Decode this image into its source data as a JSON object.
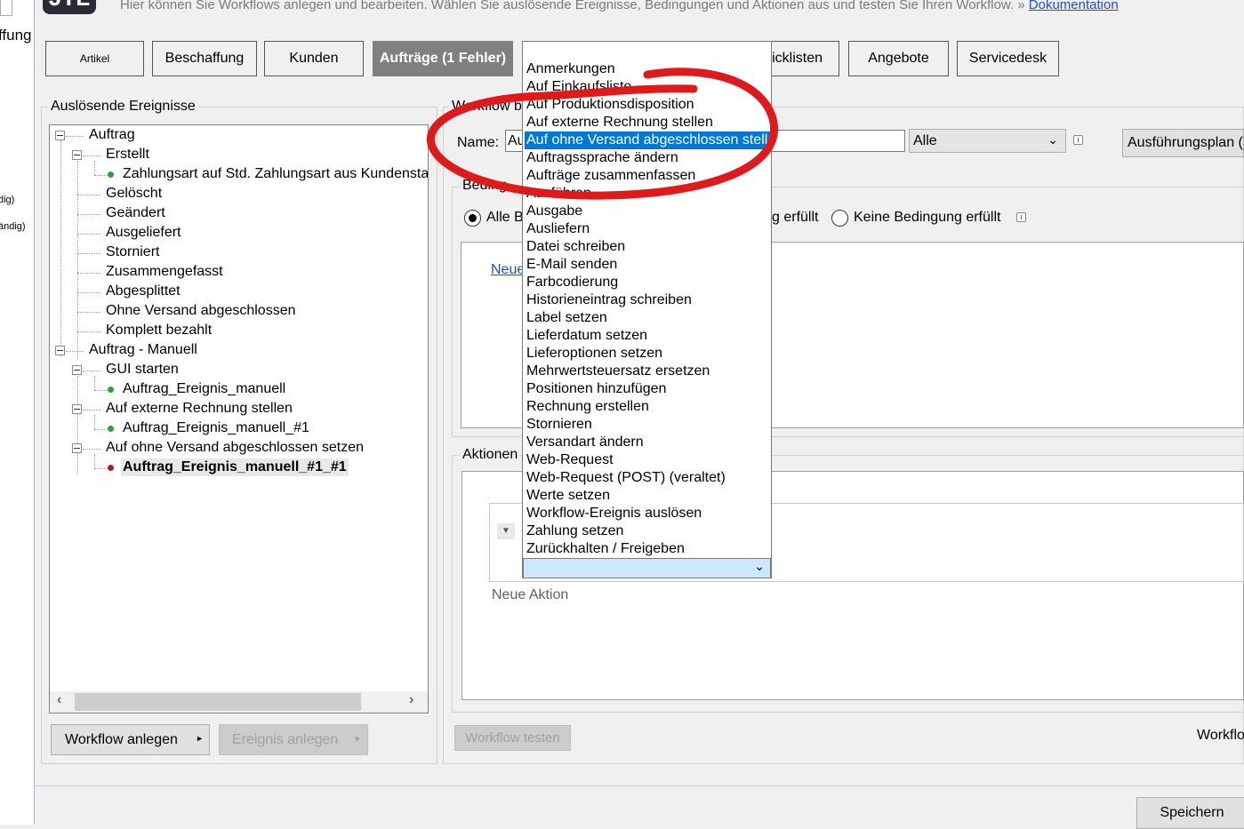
{
  "left_strip": {
    "label_top": "ffung",
    "label_a": "dig)",
    "label_b": "ändig)"
  },
  "header": {
    "logo_text": "JTL",
    "text": "Hier können Sie Workflows anlegen und bearbeiten. Wählen Sie auslösende Ereignisse, Bedingungen und Aktionen aus und testen Sie Ihren Workflow. »",
    "doc_link": "Dokumentation"
  },
  "tabs": [
    {
      "label": "Artikel"
    },
    {
      "label": "Beschaffung"
    },
    {
      "label": "Kunden"
    },
    {
      "label": "Aufträge (1 Fehler)"
    },
    {
      "label": "Picklisten",
      "partial": "icklisten"
    },
    {
      "label": "Angebote"
    },
    {
      "label": "Servicedesk"
    }
  ],
  "events_panel": {
    "title": "Auslösende Ereignisse",
    "tree": [
      {
        "label": "Auftrag"
      },
      {
        "label": "Erstellt"
      },
      {
        "label": "Zahlungsart auf Std. Zahlungsart aus Kundensta"
      },
      {
        "label": "Gelöscht"
      },
      {
        "label": "Geändert"
      },
      {
        "label": "Ausgeliefert"
      },
      {
        "label": "Storniert"
      },
      {
        "label": "Zusammengefasst"
      },
      {
        "label": "Abgesplittet"
      },
      {
        "label": "Ohne Versand abgeschlossen"
      },
      {
        "label": "Komplett bezahlt"
      },
      {
        "label": "Auftrag - Manuell"
      },
      {
        "label": "GUI starten"
      },
      {
        "label": "Auftrag_Ereignis_manuell"
      },
      {
        "label": "Auf externe Rechnung stellen"
      },
      {
        "label": "Auftrag_Ereignis_manuell_#1"
      },
      {
        "label": "Auf ohne Versand abgeschlossen setzen"
      },
      {
        "label": "Auftrag_Ereignis_manuell_#1_#1"
      }
    ],
    "btn_create_workflow": "Workflow anlegen",
    "btn_create_event": "Ereignis anlegen"
  },
  "workflow_panel": {
    "title_partial": "Workflow b",
    "name_label": "Name:",
    "name_value": "Au",
    "filter_value": "Alle",
    "exec_plan_button": "Ausführungsplan (",
    "conditions_label": "Beding",
    "radio_all": "Alle B",
    "radio_any_partial": "g erfüllt",
    "radio_none": "Keine Bedingung erfüllt",
    "new_condition_link": "Neue",
    "actions_label": "Aktionen",
    "new_action": "Neue Aktion",
    "btn_test": "Workflow testen",
    "workflow_footer_partial": "Workflo",
    "btn_save": "Speichern"
  },
  "dropdown": {
    "options": [
      "Anmerkungen",
      "Auf Einkaufsliste",
      "Auf Produktionsdisposition",
      "Auf externe Rechnung stellen",
      "Auf ohne Versand abgeschlossen stellen",
      "Auftragssprache ändern",
      "Aufträge zusammenfassen",
      "Ausführen",
      "Ausgabe",
      "Ausliefern",
      "Datei schreiben",
      "E-Mail senden",
      "Farbcodierung",
      "Historieneintrag schreiben",
      "Label setzen",
      "Lieferdatum setzen",
      "Lieferoptionen setzen",
      "Mehrwertsteuersatz ersetzen",
      "Positionen hinzufügen",
      "Rechnung erstellen",
      "Stornieren",
      "Versandart ändern",
      "Web-Request",
      "Web-Request (POST) (veraltet)",
      "Werte setzen",
      "Workflow-Ereignis auslösen",
      "Zahlung setzen",
      "Zurückhalten / Freigeben"
    ],
    "selected_index": 4
  },
  "colors": {
    "selection": "#0078d7",
    "annotation": "#e01a1a",
    "link": "#1a4fd6"
  }
}
